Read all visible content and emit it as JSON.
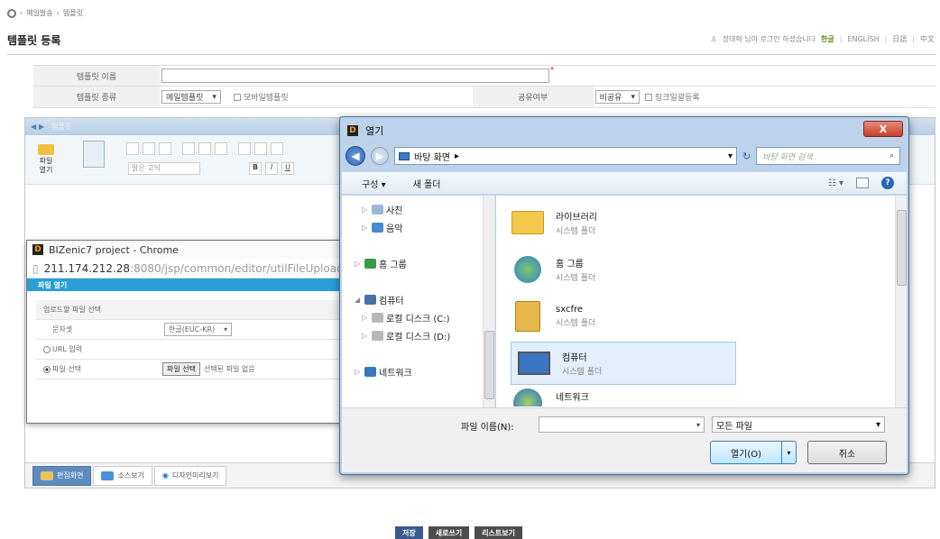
{
  "breadcrumb": [
    "메일발송",
    "템플릿"
  ],
  "page_title": "템플릿 등록",
  "topbar": {
    "login_text": "정대혁 님이 로그인 하셨습니다",
    "langs": [
      "한글",
      "ENGLISH",
      "日語",
      "中文"
    ]
  },
  "form": {
    "name_label": "템플릿 이름",
    "type_label": "템플릿 종류",
    "type_value": "메일템플릿",
    "mobile_check_label": "모바일템플릿",
    "share_label": "공유여부",
    "share_value": "비공유",
    "link_check_label": "링크일괄등록"
  },
  "editor": {
    "header_label": "템플릿",
    "file_open_label": "파일\n열기",
    "font_placeholder": "맑은 고딕",
    "bottom_tabs": [
      "편집화면",
      "소스보기",
      "디자인미리보기"
    ]
  },
  "chrome_popup": {
    "title": "BIZenic7 project - Chrome",
    "url_host": "211.174.212.28",
    "url_path": ":8080/jsp/common/editor/utilFileUpload",
    "header": "파일 열기",
    "section": "업로드할 파일 선택",
    "charset_label": "문자셋",
    "charset_value": "한글(EUC-KR)",
    "url_label": "URL 입력",
    "file_label": "파일 선택",
    "choose_button": "파일 선택",
    "no_file": "선택된 파일 없음"
  },
  "open_dialog": {
    "title": "열기",
    "close": "X",
    "address": "바탕 화면",
    "search_placeholder": "바탕 화면 검색",
    "organize": "구성 ▾",
    "new_folder": "새 폴더",
    "nav_items": [
      "사진",
      "음악",
      "홈 그룹",
      "컴퓨터",
      "로컬 디스크 (C:)",
      "로컬 디스크 (D:)",
      "네트워크"
    ],
    "items": [
      {
        "name": "라이브러리",
        "sub": "시스템 폴더"
      },
      {
        "name": "홈 그룹",
        "sub": "시스템 폴더"
      },
      {
        "name": "sxcfre",
        "sub": "시스템 폴더"
      },
      {
        "name": "컴퓨터",
        "sub": "시스템 폴더"
      },
      {
        "name": "네트워크",
        "sub": ""
      }
    ],
    "filename_label": "파일 이름(N):",
    "filetype_value": "모든 파일",
    "open_button": "열기(O)",
    "cancel_button": "취소"
  },
  "actions": [
    "저장",
    "새로쓰기",
    "리스트보기"
  ]
}
